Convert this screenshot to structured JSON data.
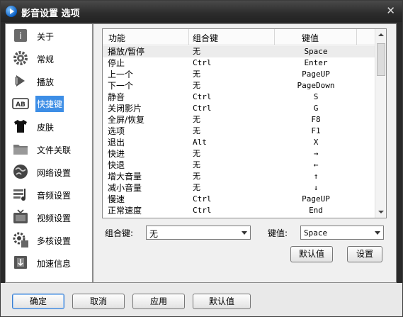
{
  "window": {
    "title": "影音设置 选项",
    "close": "✕"
  },
  "sidebar": {
    "items": [
      {
        "label": "关于",
        "icon": "about-icon"
      },
      {
        "label": "常规",
        "icon": "gear-icon"
      },
      {
        "label": "播放",
        "icon": "play-icon"
      },
      {
        "label": "快捷键",
        "icon": "keyboard-ab-icon",
        "active": true
      },
      {
        "label": "皮肤",
        "icon": "tshirt-icon"
      },
      {
        "label": "文件关联",
        "icon": "folder-icon"
      },
      {
        "label": "网络设置",
        "icon": "network-icon"
      },
      {
        "label": "音频设置",
        "icon": "audio-icon"
      },
      {
        "label": "视频设置",
        "icon": "tv-icon"
      },
      {
        "label": "多核设置",
        "icon": "multicore-icon"
      },
      {
        "label": "加速信息",
        "icon": "accelerate-icon"
      }
    ]
  },
  "table": {
    "headers": {
      "func": "功能",
      "combo": "组合键",
      "key": "键值"
    },
    "rows": [
      {
        "func": "播放/暂停",
        "combo": "无",
        "key": "Space"
      },
      {
        "func": "停止",
        "combo": "Ctrl",
        "key": "Enter"
      },
      {
        "func": "上一个",
        "combo": "无",
        "key": "PageUP"
      },
      {
        "func": "下一个",
        "combo": "无",
        "key": "PageDown"
      },
      {
        "func": "静音",
        "combo": "Ctrl",
        "key": "S"
      },
      {
        "func": "关闭影片",
        "combo": "Ctrl",
        "key": "G"
      },
      {
        "func": "全屏/恢复",
        "combo": "无",
        "key": "F8"
      },
      {
        "func": "选项",
        "combo": "无",
        "key": "F1"
      },
      {
        "func": "退出",
        "combo": "Alt",
        "key": "X"
      },
      {
        "func": "快进",
        "combo": "无",
        "key": "→"
      },
      {
        "func": "快退",
        "combo": "无",
        "key": "←"
      },
      {
        "func": "增大音量",
        "combo": "无",
        "key": "↑"
      },
      {
        "func": "减小音量",
        "combo": "无",
        "key": "↓"
      },
      {
        "func": "慢速",
        "combo": "Ctrl",
        "key": "PageUP"
      },
      {
        "func": "正常速度",
        "combo": "Ctrl",
        "key": "End"
      }
    ]
  },
  "controls": {
    "combo_label": "组合键:",
    "combo_value": "无",
    "key_label": "键值:",
    "key_value": "Space",
    "default_btn": "默认值",
    "set_btn": "设置"
  },
  "footer": {
    "ok": "确定",
    "cancel": "取消",
    "apply": "应用",
    "default": "默认值"
  }
}
